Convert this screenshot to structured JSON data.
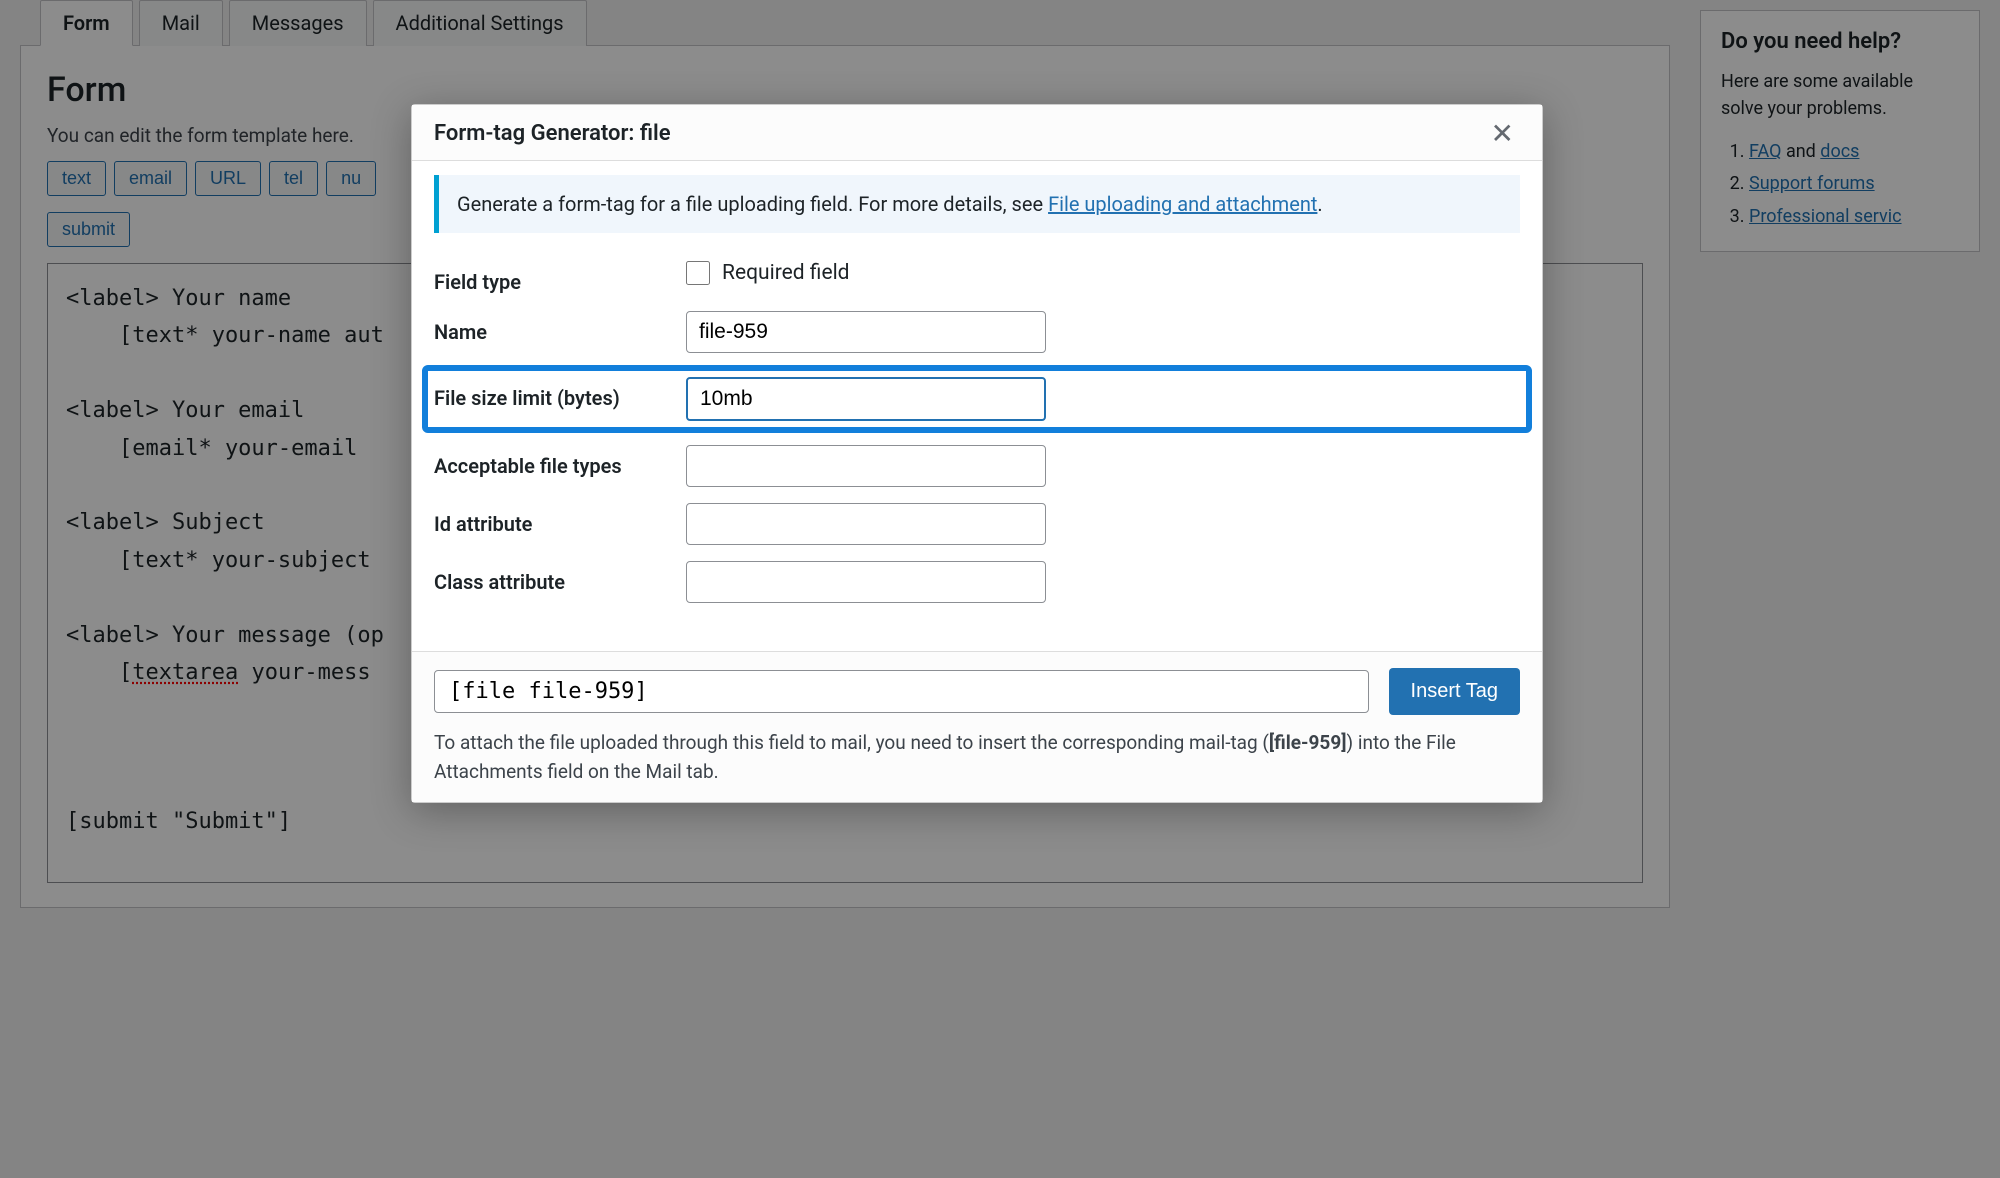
{
  "tabs": [
    "Form",
    "Mail",
    "Messages",
    "Additional Settings"
  ],
  "active_tab": "Form",
  "form_panel": {
    "heading": "Form",
    "desc": "You can edit the form template here.",
    "tag_buttons": [
      "text",
      "email",
      "URL",
      "tel",
      "nu",
      "submit"
    ],
    "code": "<label> Your name\n    [text* your-name aut\n\n<label> Your email\n    [email* your-email \n\n<label> Subject\n    [text* your-subject\n\n<label> Your message (op\n    [textarea your-mess\n\n\n\n[submit \"Submit\"]"
  },
  "help_box": {
    "title": "Do you need help?",
    "intro": "Here are some available solve your problems.",
    "links": [
      {
        "text": "FAQ",
        "suffix": " and ",
        "text2": "docs"
      },
      {
        "text": "Support forums"
      },
      {
        "text": "Professional servic"
      }
    ]
  },
  "modal": {
    "title": "Form-tag Generator: file",
    "info_text_pre": "Generate a form-tag for a file uploading field. For more details, see ",
    "info_link": "File uploading and attachment",
    "info_text_post": ".",
    "fields": {
      "field_type_label": "Field type",
      "required_label": "Required field",
      "name_label": "Name",
      "name_value": "file-959",
      "size_label": "File size limit (bytes)",
      "size_value": "10mb",
      "types_label": "Acceptable file types",
      "types_value": "",
      "id_label": "Id attribute",
      "id_value": "",
      "class_label": "Class attribute",
      "class_value": ""
    },
    "tag_output": "[file file-959]",
    "insert_label": "Insert Tag",
    "footer_note_pre": "To attach the file uploaded through this field to mail, you need to insert the corresponding mail-tag (",
    "footer_note_tag": "[file-959]",
    "footer_note_post": ") into the File Attachments field on the Mail tab."
  }
}
